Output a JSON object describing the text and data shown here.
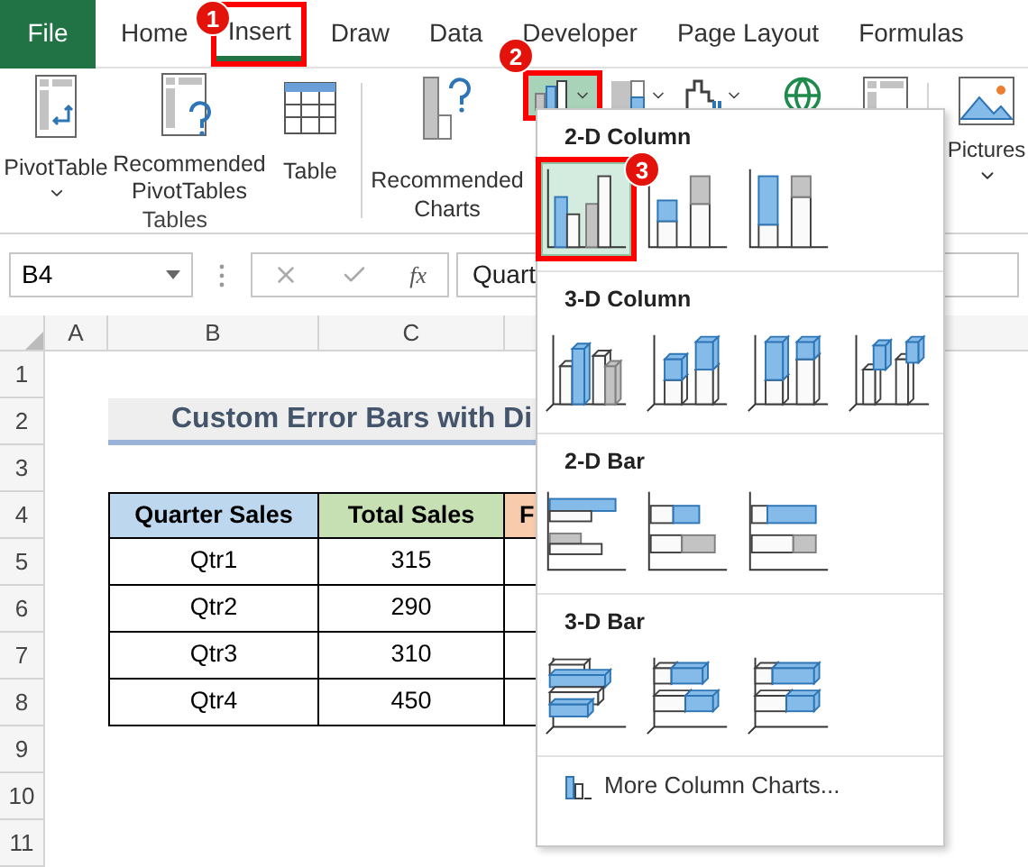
{
  "ribbon_tabs": [
    {
      "label": "File",
      "kind": "file",
      "selected": false
    },
    {
      "label": "Home",
      "kind": "tab",
      "selected": false
    },
    {
      "label": "Insert",
      "kind": "tab",
      "selected": true,
      "badge": "1"
    },
    {
      "label": "Draw",
      "kind": "tab",
      "selected": false
    },
    {
      "label": "Data",
      "kind": "tab",
      "selected": false
    },
    {
      "label": "Developer",
      "kind": "tab",
      "selected": false
    },
    {
      "label": "Page Layout",
      "kind": "tab",
      "selected": false
    },
    {
      "label": "Formulas",
      "kind": "tab",
      "selected": false
    }
  ],
  "ribbon": {
    "tables_group": {
      "label": "Tables",
      "buttons": [
        {
          "label": "PivotTable",
          "kind": "pivot",
          "caret": true
        },
        {
          "label": "Recommended PivotTables",
          "kind": "recommended-pivot"
        },
        {
          "label": "Table",
          "kind": "table"
        }
      ]
    },
    "recommended_charts": {
      "label": "Recommended Charts"
    },
    "chart_buttons": [
      {
        "kind": "column",
        "selected": true,
        "caret": true,
        "badge": "2"
      },
      {
        "kind": "hierarchy",
        "selected": false,
        "caret": true
      },
      {
        "kind": "waterfall",
        "selected": false,
        "caret": true
      },
      {
        "kind": "map",
        "selected": false,
        "caret": false
      },
      {
        "kind": "pivot-chart",
        "selected": false,
        "caret": false
      }
    ],
    "pictures": {
      "label": "Pictures",
      "caret": true
    }
  },
  "formula_bar": {
    "name_box": "B4",
    "function_label": "fx",
    "formula": "Quart"
  },
  "sheet": {
    "columns": [
      "A",
      "B",
      "C"
    ],
    "row_numbers": [
      "1",
      "2",
      "3",
      "4",
      "5",
      "6",
      "7",
      "8",
      "9",
      "10",
      "11"
    ],
    "title": "Custom Error Bars with Di",
    "table": {
      "headers": [
        {
          "text": "Quarter Sales",
          "color": "#bdd7ee"
        },
        {
          "text": "Total Sales",
          "color": "#c6e0b4"
        },
        {
          "text": "F",
          "color": "#f8cbad"
        }
      ],
      "rows": [
        [
          "Qtr1",
          "315"
        ],
        [
          "Qtr2",
          "290"
        ],
        [
          "Qtr3",
          "310"
        ],
        [
          "Qtr4",
          "450"
        ]
      ]
    }
  },
  "chart_menu": {
    "sections": [
      {
        "title": "2-D Column",
        "kind": "column2d",
        "items": [
          {
            "selected": true,
            "badge": "3"
          },
          {
            "selected": false
          },
          {
            "selected": false
          }
        ]
      },
      {
        "title": "3-D Column",
        "kind": "column3d",
        "items": [
          {
            "selected": false
          },
          {
            "selected": false
          },
          {
            "selected": false
          },
          {
            "selected": false
          }
        ]
      },
      {
        "title": "2-D Bar",
        "kind": "bar2d",
        "items": [
          {
            "selected": false
          },
          {
            "selected": false
          },
          {
            "selected": false
          }
        ]
      },
      {
        "title": "3-D Bar",
        "kind": "bar3d",
        "items": [
          {
            "selected": false
          },
          {
            "selected": false
          },
          {
            "selected": false
          }
        ]
      }
    ],
    "footer": "More Column Charts..."
  }
}
